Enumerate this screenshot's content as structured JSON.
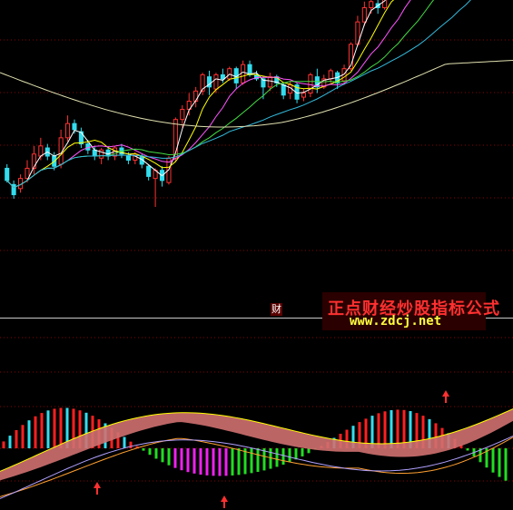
{
  "watermark": {
    "title": "正点财经炒股指标公式",
    "url": "www.zdcj.net"
  },
  "panel_label": "财",
  "colors": {
    "background": "#000000",
    "grid": "#8b0000",
    "candle_up": "#ff3333",
    "candle_down": "#33ddee",
    "ma_white": "#ffffff",
    "ma_yellow": "#ffff00",
    "ma_magenta": "#ff55ff",
    "ma_green": "#44dd44",
    "ma_cyan": "#33bbdd",
    "ma_slow": "#e0e0b0",
    "fill_band": "#d07070",
    "hist_up": "#ff2020",
    "hist_cyan": "#33ddee",
    "hist_green": "#22dd22",
    "hist_magenta": "#ee22ee",
    "signal_arrow": "#ff3030"
  },
  "chart_data": {
    "type": "candlestick",
    "candles": [
      [
        138,
        126,
        142,
        124
      ],
      [
        122,
        112,
        126,
        108
      ],
      [
        118,
        128,
        132,
        114
      ],
      [
        128,
        138,
        146,
        124
      ],
      [
        138,
        152,
        160,
        132
      ],
      [
        150,
        160,
        168,
        146
      ],
      [
        158,
        150,
        162,
        146
      ],
      [
        150,
        140,
        154,
        136
      ],
      [
        142,
        168,
        176,
        138
      ],
      [
        168,
        182,
        190,
        164
      ],
      [
        182,
        176,
        186,
        172
      ],
      [
        174,
        162,
        178,
        158
      ],
      [
        162,
        156,
        166,
        152
      ],
      [
        156,
        150,
        160,
        146
      ],
      [
        148,
        156,
        158,
        142
      ],
      [
        156,
        150,
        160,
        146
      ],
      [
        150,
        158,
        160,
        146
      ],
      [
        158,
        152,
        162,
        148
      ],
      [
        150,
        146,
        154,
        142
      ],
      [
        146,
        152,
        154,
        142
      ],
      [
        150,
        142,
        152,
        138
      ],
      [
        140,
        130,
        142,
        126
      ],
      [
        128,
        136,
        138,
        100
      ],
      [
        136,
        126,
        140,
        120
      ],
      [
        124,
        148,
        150,
        122
      ],
      [
        148,
        186,
        188,
        144
      ],
      [
        186,
        196,
        200,
        178
      ],
      [
        196,
        204,
        212,
        190
      ],
      [
        204,
        214,
        218,
        198
      ],
      [
        214,
        230,
        232,
        210
      ],
      [
        228,
        218,
        234,
        210
      ],
      [
        216,
        230,
        232,
        212
      ],
      [
        230,
        226,
        236,
        222
      ],
      [
        226,
        236,
        238,
        224
      ],
      [
        236,
        222,
        238,
        216
      ],
      [
        222,
        240,
        244,
        220
      ],
      [
        240,
        230,
        244,
        228
      ],
      [
        230,
        226,
        234,
        224
      ],
      [
        226,
        218,
        228,
        206
      ],
      [
        218,
        228,
        232,
        214
      ],
      [
        228,
        222,
        230,
        218
      ],
      [
        220,
        210,
        222,
        206
      ],
      [
        212,
        220,
        224,
        206
      ],
      [
        220,
        206,
        222,
        202
      ],
      [
        208,
        212,
        216,
        204
      ],
      [
        212,
        230,
        232,
        208
      ],
      [
        228,
        218,
        236,
        212
      ],
      [
        218,
        226,
        230,
        216
      ],
      [
        226,
        234,
        236,
        222
      ],
      [
        232,
        222,
        234,
        216
      ],
      [
        224,
        236,
        240,
        220
      ],
      [
        236,
        260,
        262,
        234
      ],
      [
        260,
        282,
        288,
        258
      ],
      [
        282,
        296,
        302,
        278
      ],
      [
        296,
        302,
        308,
        290
      ],
      [
        300,
        296,
        306,
        290
      ],
      [
        296,
        310,
        316,
        294
      ],
      [
        310,
        324,
        332,
        306
      ],
      [
        322,
        318,
        330,
        312
      ],
      [
        318,
        334,
        338,
        314
      ],
      [
        334,
        330,
        340,
        324
      ],
      [
        330,
        346,
        356,
        326
      ],
      [
        346,
        362,
        368,
        340
      ],
      [
        362,
        372,
        380,
        356
      ],
      [
        372,
        368,
        378,
        362
      ],
      [
        368,
        372,
        378,
        364
      ],
      [
        372,
        364,
        376,
        358
      ],
      [
        364,
        376,
        380,
        360
      ],
      [
        376,
        368,
        380,
        364
      ],
      [
        368,
        382,
        388,
        366
      ],
      [
        382,
        376,
        386,
        370
      ],
      [
        376,
        364,
        380,
        360
      ],
      [
        362,
        356,
        366,
        350
      ],
      [
        356,
        370,
        374,
        352
      ],
      [
        370,
        380,
        386,
        366
      ]
    ]
  }
}
